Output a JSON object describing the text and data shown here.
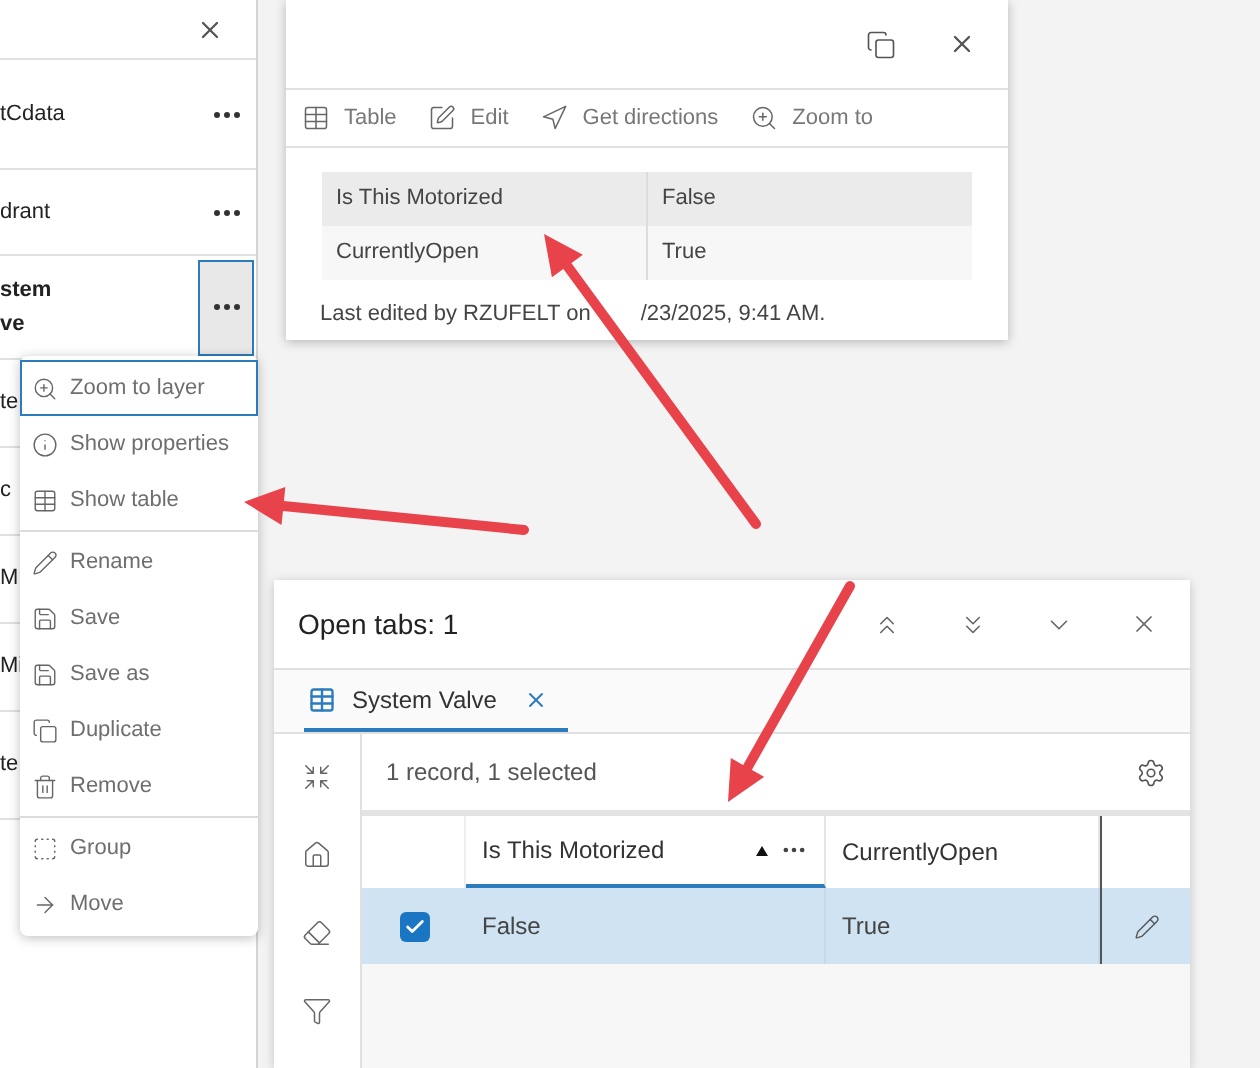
{
  "layers_panel": {
    "items": [
      {
        "lines": [
          "tCdata"
        ],
        "active": false
      },
      {
        "lines": [
          "drant"
        ],
        "active": false
      },
      {
        "lines": [
          "stem",
          "ve"
        ],
        "active": true
      },
      {
        "lines": [
          "te"
        ]
      },
      {
        "lines": [
          "c"
        ]
      },
      {
        "lines": [
          "M"
        ]
      },
      {
        "lines": [
          "Mi"
        ]
      },
      {
        "lines": [
          "te"
        ]
      }
    ]
  },
  "layer_menu": {
    "groups": [
      [
        {
          "label": "Zoom to layer",
          "focused": true
        },
        {
          "label": "Show properties",
          "focused": false
        },
        {
          "label": "Show table",
          "focused": false
        }
      ],
      [
        {
          "label": "Rename",
          "focused": false
        },
        {
          "label": "Save",
          "focused": false
        },
        {
          "label": "Save as",
          "focused": false
        },
        {
          "label": "Duplicate",
          "focused": false
        },
        {
          "label": "Remove",
          "focused": false
        }
      ],
      [
        {
          "label": "Group",
          "focused": false
        },
        {
          "label": "Move",
          "focused": false
        }
      ]
    ]
  },
  "popup": {
    "actions": [
      "Table",
      "Edit",
      "Get directions",
      "Zoom to"
    ],
    "fields": [
      {
        "name": "Is This Motorized",
        "value": "False"
      },
      {
        "name": "CurrentlyOpen",
        "value": "True"
      }
    ],
    "footer": [
      "Last edited by RZUFELT on",
      "/23/2025, 9:41 AM."
    ]
  },
  "table_panel": {
    "title": "Open tabs: 1",
    "tabs": [
      {
        "label": "System Valve",
        "selected": true
      }
    ],
    "summary": "1 record, 1 selected",
    "columns": [
      {
        "label": "Is This Motorized",
        "sorted": true
      },
      {
        "label": "CurrentlyOpen",
        "sorted": false
      }
    ],
    "rows": [
      {
        "selected": true,
        "cells": [
          "False",
          "True"
        ]
      }
    ]
  }
}
